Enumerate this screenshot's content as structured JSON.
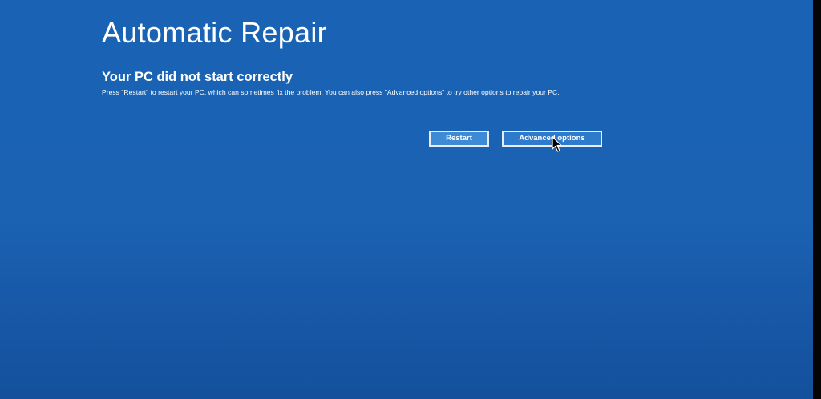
{
  "screen": {
    "title": "Automatic Repair",
    "subtitle": "Your PC did not start correctly",
    "description": "Press \"Restart\" to restart your PC, which can sometimes fix the problem. You can also press \"Advanced options\" to try other options to repair your PC."
  },
  "buttons": {
    "restart_label": "Restart",
    "advanced_label": "Advanced options"
  },
  "icons": {
    "cursor": "mouse-pointer-icon"
  },
  "colors": {
    "background": "#1a63b4",
    "button_fill": "#3d8ad6",
    "button_border": "#e8eef7",
    "text": "#ffffff"
  }
}
